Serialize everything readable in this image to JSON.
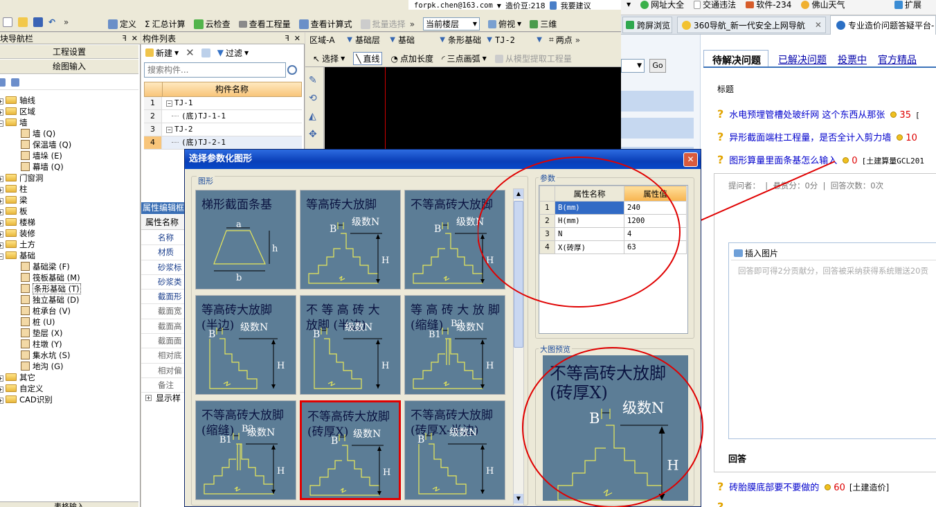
{
  "toolbar": {
    "define": "定义",
    "sum_calc": "汇总计算",
    "cloud_check": "云检查",
    "view_qty": "查看工程量",
    "view_formula": "查看计算式",
    "batch_select": "批量选择",
    "floor": "当前楼层",
    "view_mode": "俯视",
    "three_d": "三维"
  },
  "browser_top": {
    "email": "forpk.chen@163.com",
    "price": "造价豆:218",
    "suggest": "我要建议",
    "links": [
      "网址大全",
      "交通违法",
      "软件-234",
      "佛山天气"
    ],
    "expand": "扩展"
  },
  "browser_tabs": [
    {
      "label": "跨屏浏览"
    },
    {
      "label": "360导航_新一代安全上网导航"
    },
    {
      "label": "专业造价问题答疑平台-"
    }
  ],
  "nav_panel": {
    "title": "块导航栏",
    "section1": "工程设置",
    "section2": "绘图输入",
    "bottom": "表格输入",
    "tree": [
      {
        "label": "轴线",
        "level": 0,
        "type": "folder"
      },
      {
        "label": "区域",
        "level": 0,
        "type": "folder"
      },
      {
        "label": "墙",
        "level": 0,
        "type": "folder"
      },
      {
        "label": "墙 (Q)",
        "level": 1,
        "type": "leaf"
      },
      {
        "label": "保温墙 (Q)",
        "level": 1,
        "type": "leaf"
      },
      {
        "label": "墙垛 (E)",
        "level": 1,
        "type": "leaf"
      },
      {
        "label": "幕墙 (Q)",
        "level": 1,
        "type": "leaf"
      },
      {
        "label": "门窗洞",
        "level": 0,
        "type": "folder"
      },
      {
        "label": "柱",
        "level": 0,
        "type": "folder"
      },
      {
        "label": "梁",
        "level": 0,
        "type": "folder"
      },
      {
        "label": "板",
        "level": 0,
        "type": "folder"
      },
      {
        "label": "楼梯",
        "level": 0,
        "type": "folder"
      },
      {
        "label": "装修",
        "level": 0,
        "type": "folder"
      },
      {
        "label": "土方",
        "level": 0,
        "type": "folder"
      },
      {
        "label": "基础",
        "level": 0,
        "type": "folder"
      },
      {
        "label": "基础梁 (F)",
        "level": 1,
        "type": "leaf"
      },
      {
        "label": "筏板基础 (M)",
        "level": 1,
        "type": "leaf"
      },
      {
        "label": "条形基础 (T)",
        "level": 1,
        "type": "leaf",
        "selected": true
      },
      {
        "label": "独立基础 (D)",
        "level": 1,
        "type": "leaf"
      },
      {
        "label": "桩承台 (V)",
        "level": 1,
        "type": "leaf"
      },
      {
        "label": "桩 (U)",
        "level": 1,
        "type": "leaf"
      },
      {
        "label": "垫层 (X)",
        "level": 1,
        "type": "leaf"
      },
      {
        "label": "柱墩 (Y)",
        "level": 1,
        "type": "leaf"
      },
      {
        "label": "集水坑 (S)",
        "level": 1,
        "type": "leaf"
      },
      {
        "label": "地沟 (G)",
        "level": 1,
        "type": "leaf"
      },
      {
        "label": "其它",
        "level": 0,
        "type": "folder"
      },
      {
        "label": "自定义",
        "level": 0,
        "type": "folder"
      },
      {
        "label": "CAD识别",
        "level": 0,
        "type": "folder"
      }
    ]
  },
  "component_list": {
    "title": "构件列表",
    "new": "新建",
    "filter": "过滤",
    "search_placeholder": "搜索构件...",
    "col_header": "构件名称",
    "rows": [
      {
        "num": "1",
        "name": "TJ-1",
        "indent": false
      },
      {
        "num": "2",
        "name": "(底)TJ-1-1",
        "indent": true
      },
      {
        "num": "3",
        "name": "TJ-2",
        "indent": false
      },
      {
        "num": "4",
        "name": "(底)TJ-2-1",
        "indent": true,
        "selected": true
      }
    ]
  },
  "property_panel": {
    "title": "属性编辑框",
    "header": "属性名称",
    "rows": [
      "名称",
      "材质",
      "砂浆标",
      "砂浆类",
      "截面形",
      "截面宽",
      "截面高",
      "截面面",
      "相对底",
      "相对偏",
      "备注"
    ],
    "show": "显示样"
  },
  "draw_toolbar": {
    "area": "区域-A",
    "layer": "基础层",
    "type": "基础",
    "subtype": "条形基础",
    "item": "TJ-2",
    "two_points": "两点",
    "select": "选择",
    "line": "直线",
    "point_len": "点加长度",
    "arc": "三点画弧",
    "extract": "从模型提取工程量"
  },
  "dialog": {
    "title": "选择参数化图形",
    "shapes_label": "图形",
    "params_label": "参数",
    "preview_label": "大图预览",
    "tiles": [
      {
        "title": "梯形截面条基",
        "kind": "trap"
      },
      {
        "title": "等高砖大放脚",
        "kind": "step"
      },
      {
        "title": "不等高砖大放脚",
        "kind": "step"
      },
      {
        "title": "等高砖大放脚\n(半边)",
        "kind": "half"
      },
      {
        "title": "不 等 高 砖 大\n放脚 (半边)",
        "kind": "half"
      },
      {
        "title": "等 高 砖 大 放 脚\n(缩缝)",
        "kind": "gap"
      },
      {
        "title": "不等高砖大放脚\n(缩缝)",
        "kind": "gap"
      },
      {
        "title": "不等高砖大放脚\n(砖厚X)",
        "kind": "step",
        "selected": true
      },
      {
        "title": "不等高砖大放脚\n(砖厚X-半边)",
        "kind": "half"
      }
    ],
    "labels": {
      "a": "a",
      "b": "b",
      "h": "h",
      "B": "B",
      "N": "级数N",
      "H": "H",
      "B1": "B1",
      "B2": "B2"
    },
    "params_headers": [
      "属性名称",
      "属性值"
    ],
    "params": [
      {
        "num": "1",
        "name": "B(mm)",
        "value": "240"
      },
      {
        "num": "2",
        "name": "H(mm)",
        "value": "1200"
      },
      {
        "num": "3",
        "name": "N",
        "value": "4"
      },
      {
        "num": "4",
        "name": "X(砖厚)",
        "value": "63"
      }
    ],
    "preview_title": "不等高砖大放脚\n(砖厚X)"
  },
  "qa": {
    "go": "Go",
    "tabs": [
      "待解决问题",
      "已解决问题",
      "投票中",
      "官方精品"
    ],
    "title_label": "标题",
    "questions": [
      {
        "text": "水电预埋管槽处玻纤网 这个东西从那张",
        "coins": "35",
        "tag": "["
      },
      {
        "text": "异形截面端柱工程量，是否全计入剪力墙",
        "coins": "10",
        "tag": ""
      },
      {
        "text": "图形算量里面条基怎么输入",
        "coins": "0",
        "tag": "[土建算量GCL201"
      }
    ],
    "meta": "提问者：  |  悬赏分：0分  |  回答次数：0次",
    "insert_image": "插入图片",
    "answer_hint": "回答即可得2分贡献分，回答被采纳获得系统赠送20贡",
    "answer_label": "回答",
    "bottom_q": {
      "text": "砖胎膜底部要不要做的",
      "coins": "60",
      "tag": "[土建造价]"
    }
  }
}
